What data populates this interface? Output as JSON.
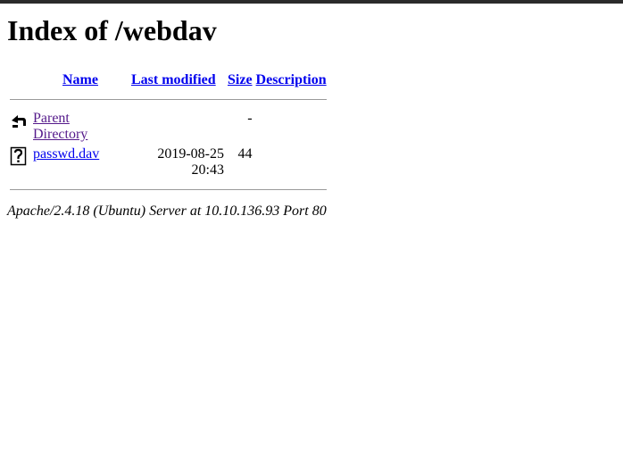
{
  "page_title": "Index of /webdav",
  "table": {
    "headers": {
      "name": "Name",
      "last_modified": "Last modified",
      "size": "Size",
      "description": "Description"
    },
    "rows": [
      {
        "icon": "back-arrow-icon",
        "name": "Parent Directory",
        "last_modified": "",
        "size": "-",
        "description": ""
      },
      {
        "icon": "unknown-file-icon",
        "name": "passwd.dav",
        "last_modified": "2019-08-25 20:43",
        "size": "44",
        "description": ""
      }
    ]
  },
  "footer": "Apache/2.4.18 (Ubuntu) Server at 10.10.136.93 Port 80"
}
